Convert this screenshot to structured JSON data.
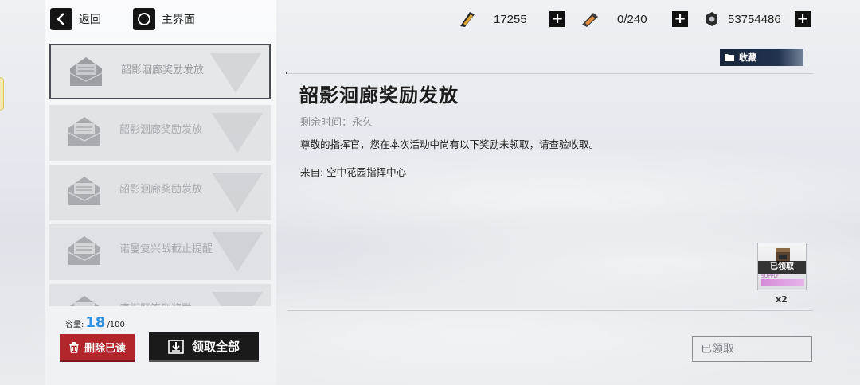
{
  "nav": {
    "back_label": "返回",
    "home_label": "主界面"
  },
  "resources": [
    {
      "icon": "ammo-ticket-icon",
      "value": "17255"
    },
    {
      "icon": "stamina-ration-icon",
      "value": "0/240"
    },
    {
      "icon": "gear-coin-icon",
      "value": "53754486"
    }
  ],
  "mail_list": [
    {
      "title": "韶影洄廊奖励发放",
      "active": true
    },
    {
      "title": "韶影洄廊奖励发放",
      "active": false
    },
    {
      "title": "韶影洄廊奖励发放",
      "active": false
    },
    {
      "title": "诺曼复兴战截止提醒",
      "active": false
    },
    {
      "title": "底街区签到奖励",
      "active": false
    }
  ],
  "capacity": {
    "label": "容量:",
    "current": "18",
    "max": "/100"
  },
  "actions": {
    "delete_read": "删除已读",
    "claim_all": "领取全部"
  },
  "detail": {
    "favorite_label": "收藏",
    "title": "韶影洄廊奖励发放",
    "remaining": "剩余时间：永久",
    "body": "尊敬的指挥官，您在本次活动中尚有以下奖励未领取，请查验收取。",
    "sender": "来自: 空中花园指挥中心",
    "reward": {
      "tag": "已领取",
      "supply_label": "SUPPLY",
      "quantity": "x2"
    },
    "claimed_button": "已领取"
  }
}
